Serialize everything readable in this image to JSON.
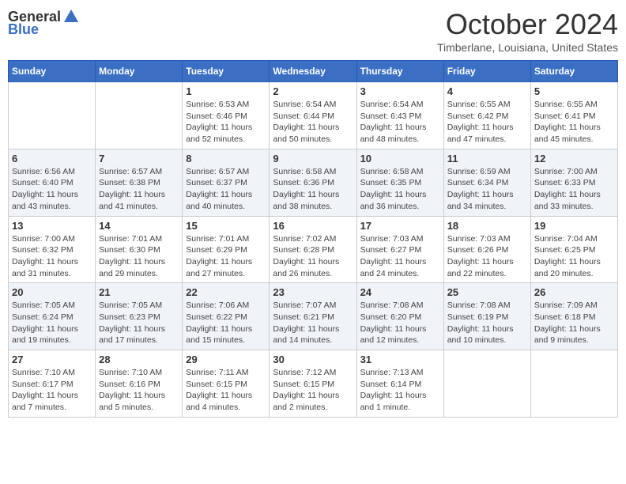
{
  "header": {
    "logo_general": "General",
    "logo_blue": "Blue",
    "month_title": "October 2024",
    "location": "Timberlane, Louisiana, United States"
  },
  "days_of_week": [
    "Sunday",
    "Monday",
    "Tuesday",
    "Wednesday",
    "Thursday",
    "Friday",
    "Saturday"
  ],
  "weeks": [
    [
      {
        "day": "",
        "info": ""
      },
      {
        "day": "",
        "info": ""
      },
      {
        "day": "1",
        "info": "Sunrise: 6:53 AM\nSunset: 6:46 PM\nDaylight: 11 hours and 52 minutes."
      },
      {
        "day": "2",
        "info": "Sunrise: 6:54 AM\nSunset: 6:44 PM\nDaylight: 11 hours and 50 minutes."
      },
      {
        "day": "3",
        "info": "Sunrise: 6:54 AM\nSunset: 6:43 PM\nDaylight: 11 hours and 48 minutes."
      },
      {
        "day": "4",
        "info": "Sunrise: 6:55 AM\nSunset: 6:42 PM\nDaylight: 11 hours and 47 minutes."
      },
      {
        "day": "5",
        "info": "Sunrise: 6:55 AM\nSunset: 6:41 PM\nDaylight: 11 hours and 45 minutes."
      }
    ],
    [
      {
        "day": "6",
        "info": "Sunrise: 6:56 AM\nSunset: 6:40 PM\nDaylight: 11 hours and 43 minutes."
      },
      {
        "day": "7",
        "info": "Sunrise: 6:57 AM\nSunset: 6:38 PM\nDaylight: 11 hours and 41 minutes."
      },
      {
        "day": "8",
        "info": "Sunrise: 6:57 AM\nSunset: 6:37 PM\nDaylight: 11 hours and 40 minutes."
      },
      {
        "day": "9",
        "info": "Sunrise: 6:58 AM\nSunset: 6:36 PM\nDaylight: 11 hours and 38 minutes."
      },
      {
        "day": "10",
        "info": "Sunrise: 6:58 AM\nSunset: 6:35 PM\nDaylight: 11 hours and 36 minutes."
      },
      {
        "day": "11",
        "info": "Sunrise: 6:59 AM\nSunset: 6:34 PM\nDaylight: 11 hours and 34 minutes."
      },
      {
        "day": "12",
        "info": "Sunrise: 7:00 AM\nSunset: 6:33 PM\nDaylight: 11 hours and 33 minutes."
      }
    ],
    [
      {
        "day": "13",
        "info": "Sunrise: 7:00 AM\nSunset: 6:32 PM\nDaylight: 11 hours and 31 minutes."
      },
      {
        "day": "14",
        "info": "Sunrise: 7:01 AM\nSunset: 6:30 PM\nDaylight: 11 hours and 29 minutes."
      },
      {
        "day": "15",
        "info": "Sunrise: 7:01 AM\nSunset: 6:29 PM\nDaylight: 11 hours and 27 minutes."
      },
      {
        "day": "16",
        "info": "Sunrise: 7:02 AM\nSunset: 6:28 PM\nDaylight: 11 hours and 26 minutes."
      },
      {
        "day": "17",
        "info": "Sunrise: 7:03 AM\nSunset: 6:27 PM\nDaylight: 11 hours and 24 minutes."
      },
      {
        "day": "18",
        "info": "Sunrise: 7:03 AM\nSunset: 6:26 PM\nDaylight: 11 hours and 22 minutes."
      },
      {
        "day": "19",
        "info": "Sunrise: 7:04 AM\nSunset: 6:25 PM\nDaylight: 11 hours and 20 minutes."
      }
    ],
    [
      {
        "day": "20",
        "info": "Sunrise: 7:05 AM\nSunset: 6:24 PM\nDaylight: 11 hours and 19 minutes."
      },
      {
        "day": "21",
        "info": "Sunrise: 7:05 AM\nSunset: 6:23 PM\nDaylight: 11 hours and 17 minutes."
      },
      {
        "day": "22",
        "info": "Sunrise: 7:06 AM\nSunset: 6:22 PM\nDaylight: 11 hours and 15 minutes."
      },
      {
        "day": "23",
        "info": "Sunrise: 7:07 AM\nSunset: 6:21 PM\nDaylight: 11 hours and 14 minutes."
      },
      {
        "day": "24",
        "info": "Sunrise: 7:08 AM\nSunset: 6:20 PM\nDaylight: 11 hours and 12 minutes."
      },
      {
        "day": "25",
        "info": "Sunrise: 7:08 AM\nSunset: 6:19 PM\nDaylight: 11 hours and 10 minutes."
      },
      {
        "day": "26",
        "info": "Sunrise: 7:09 AM\nSunset: 6:18 PM\nDaylight: 11 hours and 9 minutes."
      }
    ],
    [
      {
        "day": "27",
        "info": "Sunrise: 7:10 AM\nSunset: 6:17 PM\nDaylight: 11 hours and 7 minutes."
      },
      {
        "day": "28",
        "info": "Sunrise: 7:10 AM\nSunset: 6:16 PM\nDaylight: 11 hours and 5 minutes."
      },
      {
        "day": "29",
        "info": "Sunrise: 7:11 AM\nSunset: 6:15 PM\nDaylight: 11 hours and 4 minutes."
      },
      {
        "day": "30",
        "info": "Sunrise: 7:12 AM\nSunset: 6:15 PM\nDaylight: 11 hours and 2 minutes."
      },
      {
        "day": "31",
        "info": "Sunrise: 7:13 AM\nSunset: 6:14 PM\nDaylight: 11 hours and 1 minute."
      },
      {
        "day": "",
        "info": ""
      },
      {
        "day": "",
        "info": ""
      }
    ]
  ]
}
